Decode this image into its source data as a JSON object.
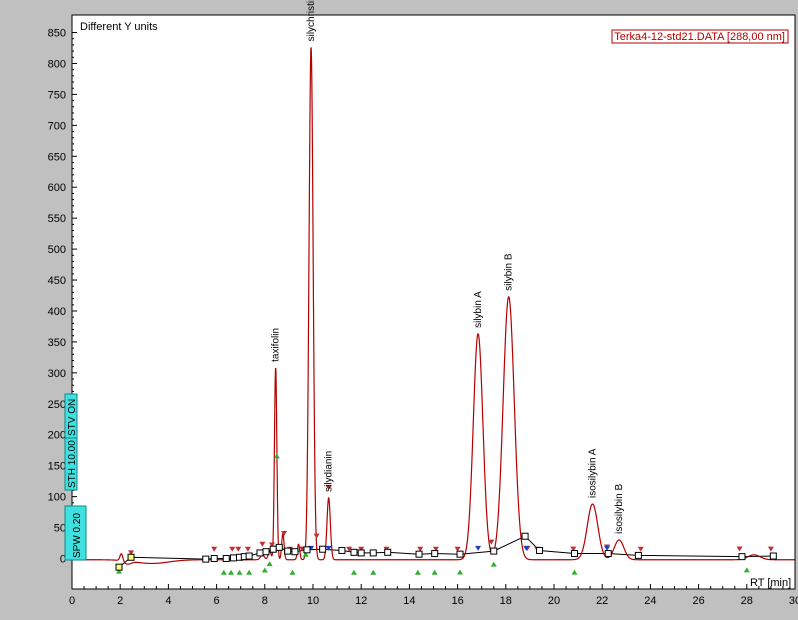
{
  "chart_data": {
    "type": "line",
    "title": "Different Y units",
    "legend": "Terka4-12-std21.DATA [288,00 nm]",
    "legend_position": "top-right",
    "xlabel": "RT [min]",
    "ylabel": "",
    "xlim": [
      0,
      30
    ],
    "ylim": [
      -30,
      850
    ],
    "x_ticks": [
      0,
      2,
      4,
      6,
      8,
      10,
      12,
      14,
      16,
      18,
      20,
      22,
      24,
      26,
      28,
      30
    ],
    "y_ticks": [
      0,
      50,
      100,
      150,
      200,
      250,
      300,
      350,
      400,
      450,
      500,
      550,
      600,
      650,
      700,
      750,
      800,
      850
    ],
    "baseline": -2,
    "peaks": [
      {
        "name": "taxifolin",
        "rt": 8.45,
        "height": 310,
        "width": 0.05
      },
      {
        "name": "silychristin",
        "rt": 9.92,
        "height": 828,
        "width": 0.085
      },
      {
        "name": "silydianin",
        "rt": 10.65,
        "height": 100,
        "width": 0.07
      },
      {
        "name": "silybin A",
        "rt": 16.85,
        "height": 365,
        "width": 0.2
      },
      {
        "name": "silybin B",
        "rt": 18.12,
        "height": 425,
        "width": 0.23
      },
      {
        "name": "isosilybin A",
        "rt": 21.6,
        "height": 90,
        "width": 0.22
      },
      {
        "name": "isosilybin B",
        "rt": 22.7,
        "height": 32,
        "width": 0.2
      }
    ],
    "minor_peaks": [
      {
        "rt": 2.05,
        "height": 12,
        "width": 0.06
      },
      {
        "rt": 7.9,
        "height": 8,
        "width": 0.08
      },
      {
        "rt": 8.2,
        "height": 14,
        "width": 0.06
      },
      {
        "rt": 8.75,
        "height": 42,
        "width": 0.05
      },
      {
        "rt": 9.4,
        "height": 25,
        "width": 0.05
      },
      {
        "rt": 28.3,
        "height": 8,
        "width": 0.25
      }
    ],
    "dips": [
      {
        "rt": 2.3,
        "depth": 5,
        "width": 0.15
      },
      {
        "rt": 3.3,
        "depth": 6,
        "width": 0.7
      }
    ],
    "baseline_points": [
      {
        "x": 1.95,
        "y": -14
      },
      {
        "x": 2.45,
        "y": 2
      },
      {
        "x": 5.55,
        "y": -1
      },
      {
        "x": 5.9,
        "y": 0
      },
      {
        "x": 6.4,
        "y": 0
      },
      {
        "x": 6.7,
        "y": 1
      },
      {
        "x": 6.95,
        "y": 2
      },
      {
        "x": 7.15,
        "y": 3
      },
      {
        "x": 7.35,
        "y": 4
      },
      {
        "x": 7.8,
        "y": 9
      },
      {
        "x": 8.05,
        "y": 11
      },
      {
        "x": 8.35,
        "y": 15
      },
      {
        "x": 8.6,
        "y": 18
      },
      {
        "x": 8.95,
        "y": 12
      },
      {
        "x": 9.25,
        "y": 11
      },
      {
        "x": 9.75,
        "y": 14
      },
      {
        "x": 10.4,
        "y": 15
      },
      {
        "x": 11.2,
        "y": 13
      },
      {
        "x": 11.7,
        "y": 10
      },
      {
        "x": 12.0,
        "y": 9
      },
      {
        "x": 12.5,
        "y": 9
      },
      {
        "x": 13.1,
        "y": 10
      },
      {
        "x": 14.4,
        "y": 7
      },
      {
        "x": 15.05,
        "y": 8
      },
      {
        "x": 16.1,
        "y": 7
      },
      {
        "x": 17.5,
        "y": 12
      },
      {
        "x": 18.8,
        "y": 36
      },
      {
        "x": 19.4,
        "y": 13
      },
      {
        "x": 20.85,
        "y": 8
      },
      {
        "x": 22.25,
        "y": 8
      },
      {
        "x": 23.5,
        "y": 5
      },
      {
        "x": 27.8,
        "y": 3
      },
      {
        "x": 29.1,
        "y": 4
      }
    ],
    "start_markers_x": [
      2.45,
      5.9,
      6.65,
      6.9,
      7.3,
      7.9,
      8.3,
      8.8,
      9.05,
      9.55,
      10.15,
      10.65,
      11.5,
      12.0,
      13.05,
      14.45,
      15.1,
      16.0,
      17.4,
      18.9,
      19.3,
      20.8,
      22.2,
      23.6,
      27.7,
      29.0
    ],
    "end_markers_x": [
      1.95,
      6.3,
      6.6,
      6.95,
      7.35,
      8.0,
      8.2,
      8.5,
      9.15,
      9.7,
      11.7,
      12.5,
      14.35,
      15.05,
      16.1,
      17.5,
      20.85,
      28.0
    ],
    "apex_markers_x": [
      8.45,
      9.92,
      10.65,
      16.85,
      18.85,
      22.2
    ],
    "side_labels": [
      "SPW 0.20",
      "STH 10.00",
      "STV ON"
    ]
  }
}
